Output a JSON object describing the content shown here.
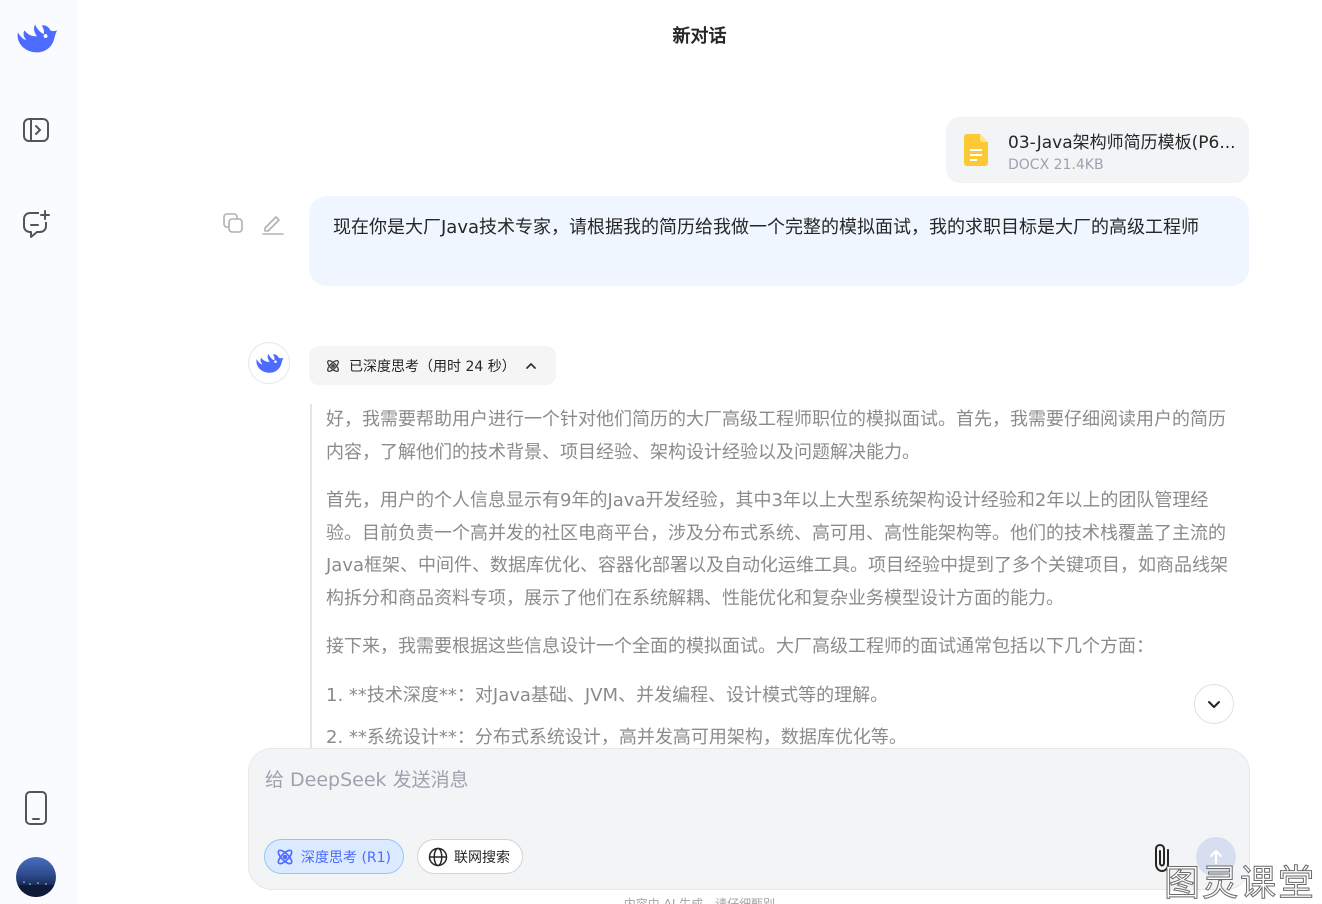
{
  "header": {
    "title": "新对话"
  },
  "attachment": {
    "name": "03-Java架构师简历模板(P6...",
    "meta": "DOCX 21.4KB"
  },
  "user_message": {
    "text": "现在你是大厂Java技术专家，请根据我的简历给我做一个完整的模拟面试，我的求职目标是大厂的高级工程师"
  },
  "assistant": {
    "think_label": "已深度思考（用时 24 秒）",
    "paragraphs": [
      "好，我需要帮助用户进行一个针对他们简历的大厂高级工程师职位的模拟面试。首先，我需要仔细阅读用户的简历内容，了解他们的技术背景、项目经验、架构设计经验以及问题解决能力。",
      "首先，用户的个人信息显示有9年的Java开发经验，其中3年以上大型系统架构设计经验和2年以上的团队管理经验。目前负责一个高并发的社区电商平台，涉及分布式系统、高可用、高性能架构等。他们的技术栈覆盖了主流的Java框架、中间件、数据库优化、容器化部署以及自动化运维工具。项目经验中提到了多个关键项目，如商品线架构拆分和商品资料专项，展示了他们在系统解耦、性能优化和复杂业务模型设计方面的能力。",
      "接下来，我需要根据这些信息设计一个全面的模拟面试。大厂高级工程师的面试通常包括以下几个方面：",
      "1. **技术深度**：对Java基础、JVM、并发编程、设计模式等的理解。",
      "2. **系统设计**：分布式系统设计，高并发高可用架构，数据库优化等。"
    ]
  },
  "input": {
    "placeholder": "给 DeepSeek 发送消息"
  },
  "chips": {
    "deep_think": "深度思考 (R1)",
    "web_search": "联网搜索"
  },
  "footer": {
    "disclaimer": "内容由 AI 生成，请仔细甄别"
  },
  "watermark": "图灵课堂",
  "colors": {
    "accent": "#4d6bfe",
    "bubble": "#eff6ff",
    "sidebar": "#f9fbff"
  }
}
